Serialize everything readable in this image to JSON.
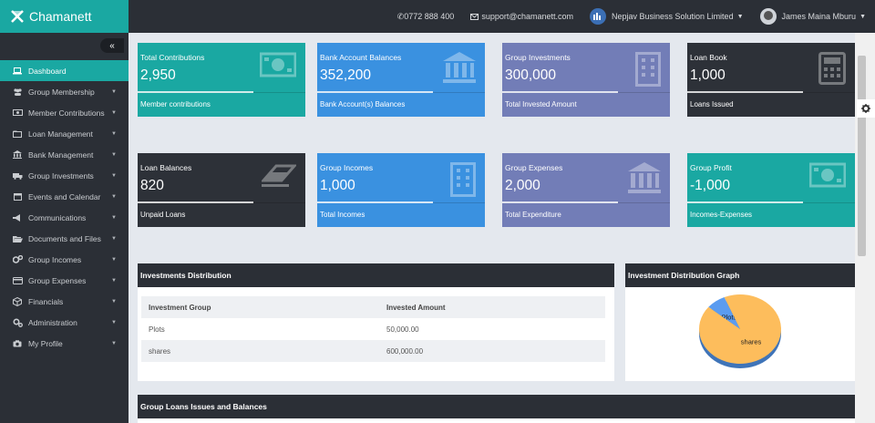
{
  "app": {
    "brand": "Chamanett"
  },
  "header": {
    "phone": "0772 888 400",
    "email": "support@chamanett.com",
    "organization": "Nepjav Business Solution Limited",
    "user": "James Maina Mburu"
  },
  "sidebar": {
    "items": [
      {
        "label": "Dashboard",
        "icon": "laptop-icon",
        "active": true
      },
      {
        "label": "Group Membership",
        "icon": "users-icon"
      },
      {
        "label": "Member Contributions",
        "icon": "money-icon"
      },
      {
        "label": "Loan Management",
        "icon": "folder-icon"
      },
      {
        "label": "Bank Management",
        "icon": "bank-icon"
      },
      {
        "label": "Group Investments",
        "icon": "truck-icon"
      },
      {
        "label": "Events and Calendar",
        "icon": "calendar-icon"
      },
      {
        "label": "Communications",
        "icon": "bullhorn-icon"
      },
      {
        "label": "Documents and Files",
        "icon": "folder-open-icon"
      },
      {
        "label": "Group Incomes",
        "icon": "cogs-icon"
      },
      {
        "label": "Group Expenses",
        "icon": "credit-card-icon"
      },
      {
        "label": "Financials",
        "icon": "cube-icon"
      },
      {
        "label": "Administration",
        "icon": "gears-icon"
      },
      {
        "label": "My Profile",
        "icon": "camera-icon"
      }
    ]
  },
  "cards": [
    {
      "title": "Total Contributions",
      "value": "2,950",
      "sub": "Member contributions",
      "color": "#1aa8a2",
      "icon": "money-icon"
    },
    {
      "title": "Bank Account Balances",
      "value": "352,200",
      "sub": "Bank Account(s) Balances",
      "color": "#3a91e0",
      "icon": "bank-icon"
    },
    {
      "title": "Group Investments",
      "value": "300,000",
      "sub": "Total Invested Amount",
      "color": "#727db7",
      "icon": "building-icon"
    },
    {
      "title": "Loan Book",
      "value": "1,000",
      "sub": "Loans Issued",
      "color": "#2d3138",
      "icon": "calculator-icon"
    },
    {
      "title": "Loan Balances",
      "value": "820",
      "sub": "Unpaid Loans",
      "color": "#2d3138",
      "icon": "eraser-icon"
    },
    {
      "title": "Group Incomes",
      "value": "1,000",
      "sub": "Total Incomes",
      "color": "#3a91e0",
      "icon": "building-icon"
    },
    {
      "title": "Group Expenses",
      "value": "2,000",
      "sub": "Total Expenditure",
      "color": "#727db7",
      "icon": "bank-icon"
    },
    {
      "title": "Group Profit",
      "value": "-1,000",
      "sub": "Incomes-Expenses",
      "color": "#1aa8a2",
      "icon": "money-icon"
    }
  ],
  "investments": {
    "heading": "Investments Distribution",
    "columns": [
      "Investment Group",
      "Invested Amount"
    ],
    "rows": [
      [
        "Plots",
        "50,000.00"
      ],
      [
        "shares",
        "600,000.00"
      ]
    ]
  },
  "graph": {
    "heading": "Investment Distribution Graph",
    "slices": [
      {
        "label": "Plots",
        "color": "#5b9cf0",
        "value": 50000
      },
      {
        "label": "shares",
        "color": "#fdbd5c",
        "value": 600000
      }
    ]
  },
  "loans_panel": {
    "heading": "Group Loans Issues and Balances"
  }
}
